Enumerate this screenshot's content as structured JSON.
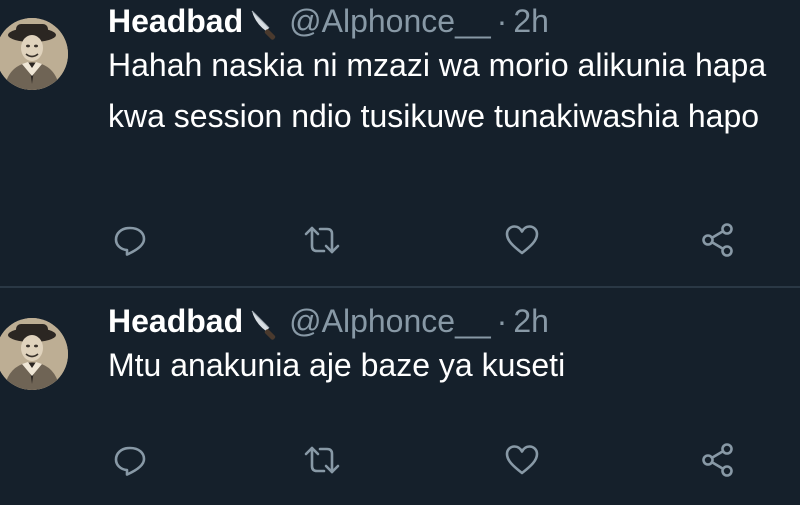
{
  "tweets": [
    {
      "author_name": "Headbad",
      "author_emoji_icon": "kitchen-knife-icon",
      "handle": "@Alphonce__",
      "separator": "·",
      "time": "2h",
      "text": "Hahah naskia ni mzazi wa morio alikunia hapa kwa session ndio tusikuwe tunakiwashia hapo",
      "actions": [
        "reply-icon",
        "retweet-icon",
        "like-icon",
        "share-icon"
      ]
    },
    {
      "author_name": "Headbad",
      "author_emoji_icon": "kitchen-knife-icon",
      "handle": "@Alphonce__",
      "separator": "·",
      "time": "2h",
      "text": "Mtu anakunia aje baze ya kuseti",
      "actions": [
        "reply-icon",
        "retweet-icon",
        "like-icon",
        "share-icon"
      ]
    }
  ],
  "colors": {
    "background": "#15202b",
    "primary_text": "#ffffff",
    "secondary_text": "#8899a6",
    "divider": "#2a3845"
  }
}
